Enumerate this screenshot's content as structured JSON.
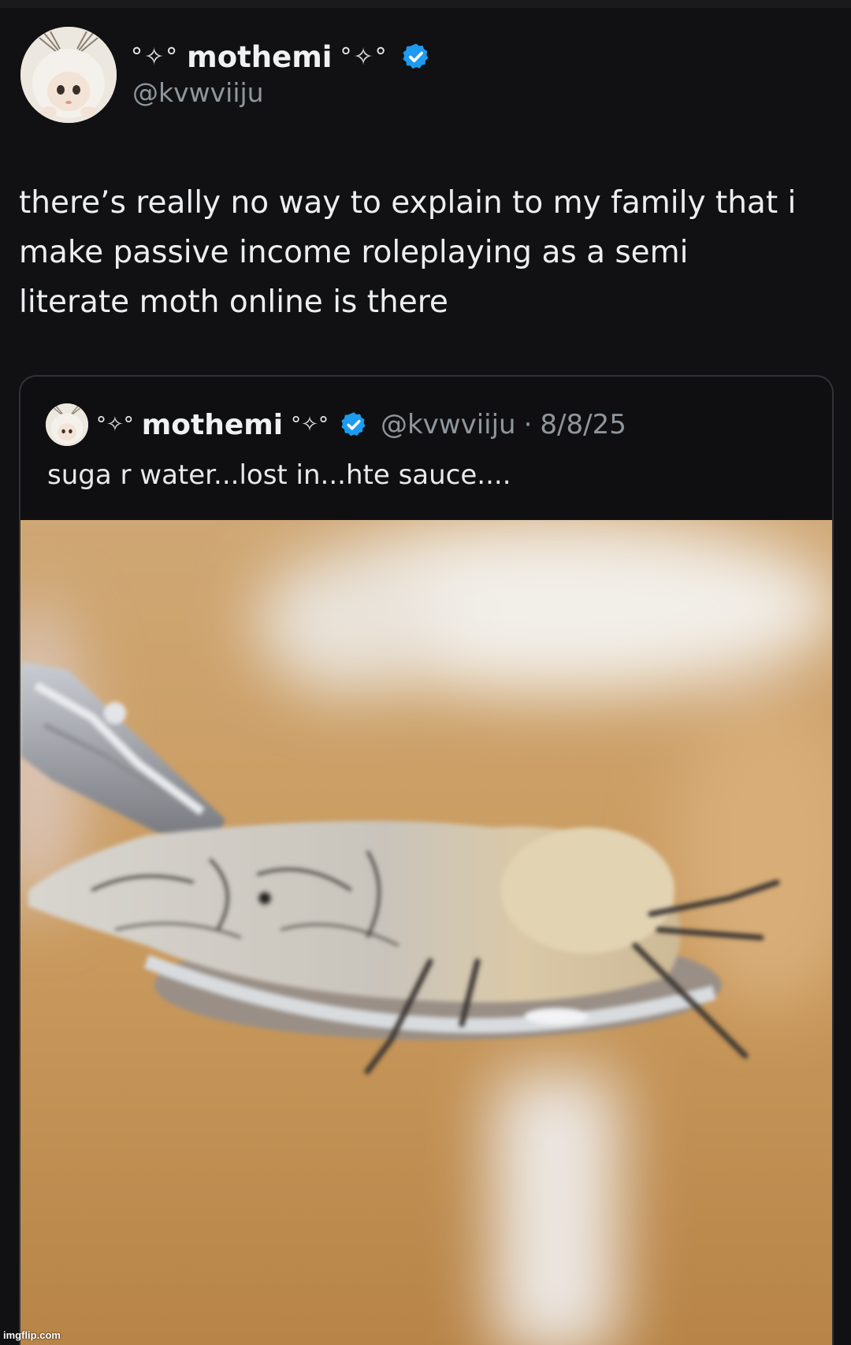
{
  "tweet": {
    "display_name": "mothemi",
    "name_decoration_left": "°✧°",
    "name_decoration_right": "°✧°",
    "handle": "@kvwviiju",
    "text": "there’s really no way to explain to my family that i\nmake passive income roleplaying as a semi\nliterate moth online is there"
  },
  "quoted_tweet": {
    "display_name": "mothemi",
    "name_decoration_left": "°✧°",
    "name_decoration_right": "°✧°",
    "handle": "@kvwviiju",
    "separator": "·",
    "date": "8/8/25",
    "text": "suga r water...lost in...hte sauce...."
  },
  "watermark": "imgflip.com",
  "icons": {
    "verified": "verified-badge-icon",
    "avatar": "moth-doll-avatar"
  },
  "colors": {
    "background": "#111113",
    "text": "#e7e9ea",
    "muted": "#8f969c",
    "verified": "#1d9bf0",
    "border": "#2f3336"
  }
}
